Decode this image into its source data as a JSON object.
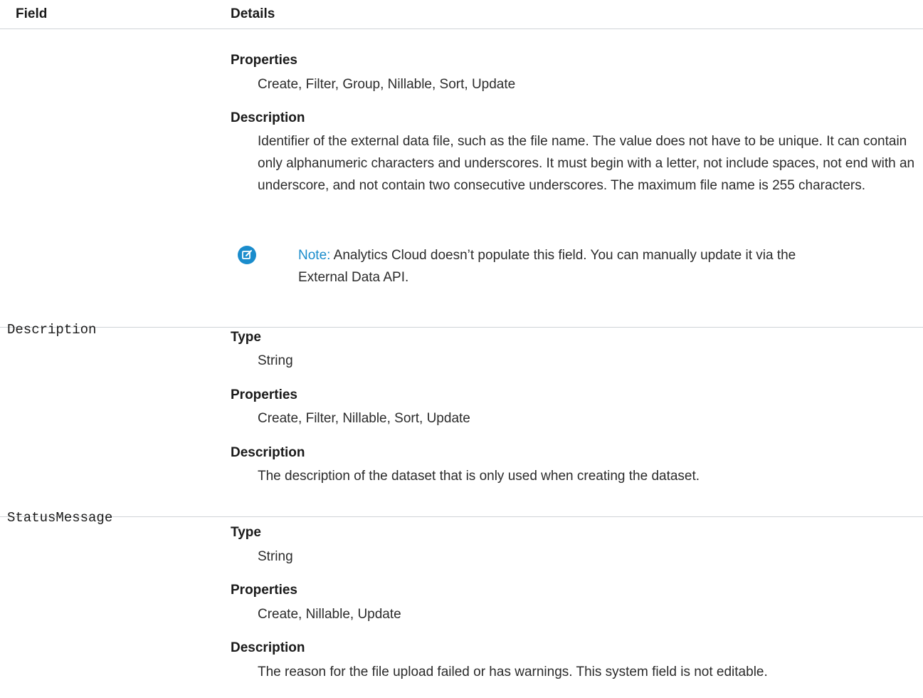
{
  "header": {
    "field": "Field",
    "details": "Details"
  },
  "row1": {
    "properties_term": "Properties",
    "properties_value": "Create, Filter, Group, Nillable, Sort, Update",
    "description_term": "Description",
    "description_value": "Identifier of the external data file, such as the file name. The value does not have to be unique. It can contain only alphanumeric characters and underscores. It must begin with a letter, not include spaces, not end with an underscore, and not contain two consecutive underscores. The maximum file name is 255 characters.",
    "note_label": "Note:",
    "note_text_line1": "Analytics Cloud doesn’t populate this field. You can manually update it via the",
    "note_text_line2": "External Data API."
  },
  "row2": {
    "field_name": "Description",
    "type_term": "Type",
    "type_value": "String",
    "properties_term": "Properties",
    "properties_value": "Create, Filter, Nillable, Sort, Update",
    "description_term": "Description",
    "description_value": "The description of the dataset that is only used when creating the dataset."
  },
  "row3": {
    "field_name": "StatusMessage",
    "type_term": "Type",
    "type_value": "String",
    "properties_term": "Properties",
    "properties_value": "Create, Nillable, Update",
    "description_term": "Description",
    "description_value": "The reason for the file upload failed or has warnings. This system field is not editable."
  },
  "colors": {
    "note_accent": "#1a8ccc",
    "divider": "#cfd3d7"
  },
  "icons": {
    "note": "edit-note-icon"
  }
}
